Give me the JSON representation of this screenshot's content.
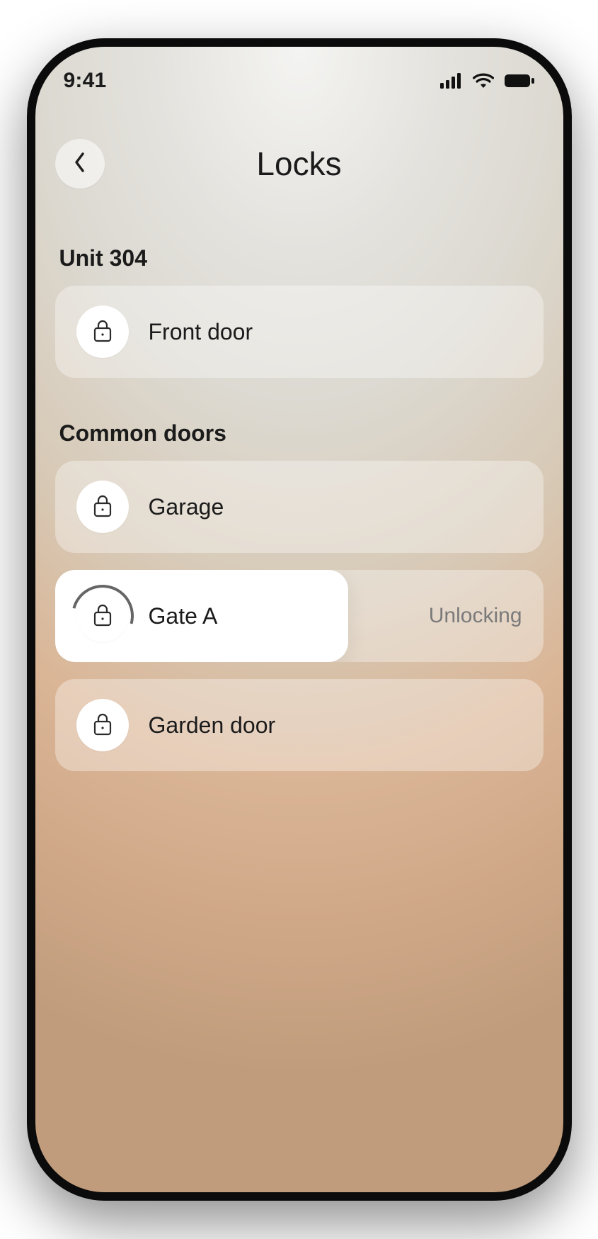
{
  "status": {
    "time": "9:41"
  },
  "header": {
    "title": "Locks"
  },
  "sections": [
    {
      "title": "Unit 304",
      "locks": [
        {
          "label": "Front door",
          "status": "",
          "progress": 0,
          "loading": ""
        }
      ]
    },
    {
      "title": "Common doors",
      "locks": [
        {
          "label": "Garage",
          "status": "",
          "progress": 0,
          "loading": ""
        },
        {
          "label": "Gate A",
          "status": "Unlocking",
          "progress": 60,
          "loading": "loading"
        },
        {
          "label": "Garden door",
          "status": "",
          "progress": 0,
          "loading": ""
        }
      ]
    }
  ]
}
